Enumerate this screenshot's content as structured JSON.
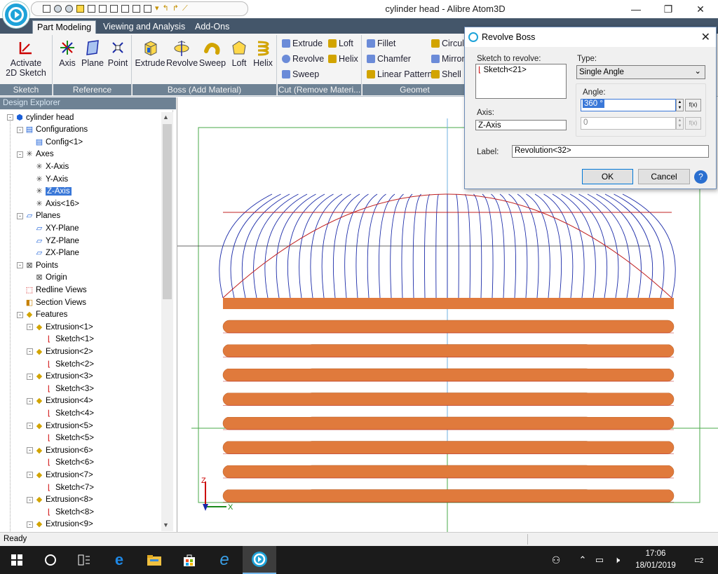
{
  "window": {
    "title": "cylinder head - Alibre Atom3D",
    "min": "—",
    "max": "❐",
    "close": "✕"
  },
  "ribbon": {
    "tabs": [
      "Part Modeling",
      "Viewing and Analysis",
      "Add-Ons"
    ],
    "groups": {
      "sketch": {
        "label": "Sketch",
        "activate_line1": "Activate",
        "activate_line2": "2D Sketch"
      },
      "reference": {
        "label": "Reference",
        "axis": "Axis",
        "plane": "Plane",
        "point": "Point"
      },
      "boss": {
        "label": "Boss (Add Material)",
        "extrude": "Extrude",
        "revolve": "Revolve",
        "sweep": "Sweep",
        "loft": "Loft",
        "helix": "Helix"
      },
      "cut": {
        "label": "Cut (Remove Materi...",
        "extrude": "Extrude",
        "loft": "Loft",
        "revolve": "Revolve",
        "helix": "Helix",
        "sweep": "Sweep"
      },
      "geometry": {
        "label": "Geomet",
        "fillet": "Fillet",
        "chamfer": "Chamfer",
        "linear_pattern": "Linear Pattern",
        "circular": "Circul",
        "mirror": "Mirror",
        "shell": "Shell"
      }
    }
  },
  "explorer": {
    "title": "Design Explorer",
    "items": [
      {
        "label": "cylinder head",
        "level": 0,
        "icon": "part-icon",
        "expand": "-"
      },
      {
        "label": "Configurations",
        "level": 1,
        "icon": "config-icon",
        "expand": "-"
      },
      {
        "label": "Config<1>",
        "level": 2,
        "icon": "config-icon",
        "expand": ""
      },
      {
        "label": "Axes",
        "level": 1,
        "icon": "axis-icon",
        "expand": "-"
      },
      {
        "label": "X-Axis",
        "level": 2,
        "icon": "axis-icon",
        "expand": ""
      },
      {
        "label": "Y-Axis",
        "level": 2,
        "icon": "axis-icon",
        "expand": ""
      },
      {
        "label": "Z-Axis",
        "level": 2,
        "icon": "axis-icon",
        "expand": "",
        "selected": true
      },
      {
        "label": "Axis<16>",
        "level": 2,
        "icon": "axis-icon",
        "expand": ""
      },
      {
        "label": "Planes",
        "level": 1,
        "icon": "plane-icon",
        "expand": "-"
      },
      {
        "label": "XY-Plane",
        "level": 2,
        "icon": "plane-icon",
        "expand": ""
      },
      {
        "label": "YZ-Plane",
        "level": 2,
        "icon": "plane-icon",
        "expand": ""
      },
      {
        "label": "ZX-Plane",
        "level": 2,
        "icon": "plane-icon",
        "expand": ""
      },
      {
        "label": "Points",
        "level": 1,
        "icon": "point-icon",
        "expand": "-"
      },
      {
        "label": "Origin",
        "level": 2,
        "icon": "point-icon",
        "expand": ""
      },
      {
        "label": "Redline Views",
        "level": 1,
        "icon": "redline-icon",
        "expand": ""
      },
      {
        "label": "Section Views",
        "level": 1,
        "icon": "section-icon",
        "expand": ""
      },
      {
        "label": "Features",
        "level": 1,
        "icon": "features-icon",
        "expand": "-"
      },
      {
        "label": "Extrusion<1>",
        "level": 2,
        "icon": "extrusion-icon",
        "expand": "-"
      },
      {
        "label": "Sketch<1>",
        "level": 3,
        "icon": "sketch-icon",
        "expand": ""
      },
      {
        "label": "Extrusion<2>",
        "level": 2,
        "icon": "extrusion-icon",
        "expand": "-"
      },
      {
        "label": "Sketch<2>",
        "level": 3,
        "icon": "sketch-icon",
        "expand": ""
      },
      {
        "label": "Extrusion<3>",
        "level": 2,
        "icon": "extrusion-icon",
        "expand": "-"
      },
      {
        "label": "Sketch<3>",
        "level": 3,
        "icon": "sketch-icon",
        "expand": ""
      },
      {
        "label": "Extrusion<4>",
        "level": 2,
        "icon": "extrusion-icon",
        "expand": "-"
      },
      {
        "label": "Sketch<4>",
        "level": 3,
        "icon": "sketch-icon",
        "expand": ""
      },
      {
        "label": "Extrusion<5>",
        "level": 2,
        "icon": "extrusion-icon",
        "expand": "-"
      },
      {
        "label": "Sketch<5>",
        "level": 3,
        "icon": "sketch-icon",
        "expand": ""
      },
      {
        "label": "Extrusion<6>",
        "level": 2,
        "icon": "extrusion-icon",
        "expand": "-"
      },
      {
        "label": "Sketch<6>",
        "level": 3,
        "icon": "sketch-icon",
        "expand": ""
      },
      {
        "label": "Extrusion<7>",
        "level": 2,
        "icon": "extrusion-icon",
        "expand": "-"
      },
      {
        "label": "Sketch<7>",
        "level": 3,
        "icon": "sketch-icon",
        "expand": ""
      },
      {
        "label": "Extrusion<8>",
        "level": 2,
        "icon": "extrusion-icon",
        "expand": "-"
      },
      {
        "label": "Sketch<8>",
        "level": 3,
        "icon": "sketch-icon",
        "expand": ""
      },
      {
        "label": "Extrusion<9>",
        "level": 2,
        "icon": "extrusion-icon",
        "expand": "-"
      }
    ]
  },
  "viewport": {
    "triad_z": "Z",
    "triad_x": "X",
    "fin_count": 8,
    "dome_meridians": 40
  },
  "dialog": {
    "title": "Revolve Boss",
    "sketch_label": "Sketch to revolve:",
    "sketch_value": "Sketch<21>",
    "axis_label": "Axis:",
    "axis_value": "Z-Axis",
    "type_label": "Type:",
    "type_value": "Single Angle",
    "angle_label": "Angle:",
    "angle_value": "360 °",
    "angle2_value": "0",
    "fx": "f(x)",
    "label_label": "Label:",
    "label_value": "Revolution<32>",
    "ok": "OK",
    "cancel": "Cancel",
    "help": "?"
  },
  "status": {
    "text": "Ready"
  },
  "taskbar": {
    "time": "17:06",
    "date": "18/01/2019",
    "notifications": "2"
  },
  "colors": {
    "fin": "#e07a3c",
    "dome_lines": "#1a2aa8",
    "ribbon_dark": "#44566a",
    "selection": "#3a78d8"
  }
}
